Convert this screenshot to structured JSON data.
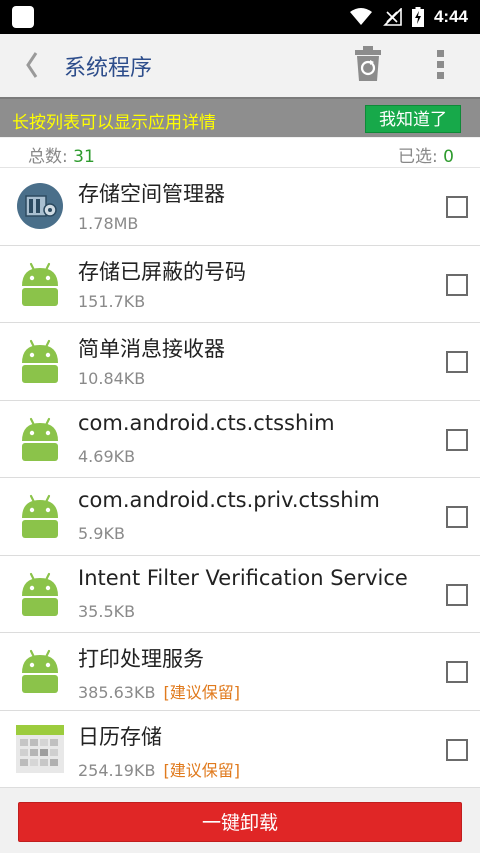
{
  "status_bar": {
    "time": "4:44"
  },
  "app_bar": {
    "title": "系统程序"
  },
  "hint": {
    "text": "长按列表可以显示应用详情",
    "button": "我知道了"
  },
  "summary": {
    "total_label": "总数:",
    "total_value": "31",
    "selected_label": "已选:",
    "selected_value": "0"
  },
  "apps": [
    {
      "name": "存储空间管理器",
      "size": "1.78MB",
      "tag": "",
      "icon": "storage-manager-icon"
    },
    {
      "name": "存储已屏蔽的号码",
      "size": "151.7KB",
      "tag": "",
      "icon": "android-icon"
    },
    {
      "name": "简单消息接收器",
      "size": "10.84KB",
      "tag": "",
      "icon": "android-icon"
    },
    {
      "name": "com.android.cts.ctsshim",
      "size": "4.69KB",
      "tag": "",
      "icon": "android-icon"
    },
    {
      "name": "com.android.cts.priv.ctsshim",
      "size": "5.9KB",
      "tag": "",
      "icon": "android-icon"
    },
    {
      "name": "Intent Filter Verification Service",
      "size": "35.5KB",
      "tag": "",
      "icon": "android-icon"
    },
    {
      "name": "打印处理服务",
      "size": "385.63KB",
      "tag": "[建议保留]",
      "icon": "android-icon"
    },
    {
      "name": "日历存储",
      "size": "254.19KB",
      "tag": "[建议保留]",
      "icon": "calendar-storage-icon"
    }
  ],
  "bottom": {
    "uninstall_button": "一键卸载"
  },
  "colors": {
    "accent_green": "#17a94a",
    "danger_red": "#e02626",
    "title_blue": "#2d4d8b",
    "hint_yellow": "#ffff00",
    "tag_orange": "#e07a1d"
  }
}
